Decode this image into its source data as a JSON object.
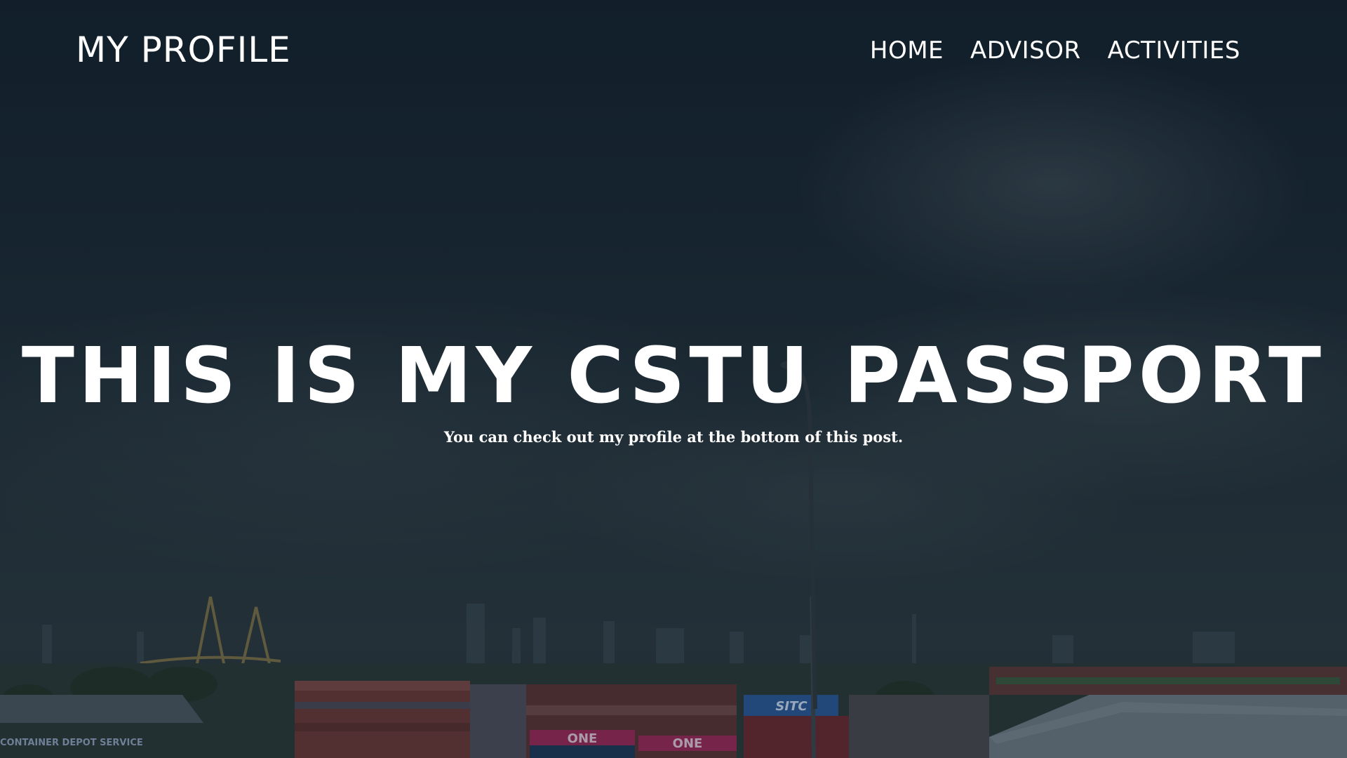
{
  "header": {
    "brand": "MY PROFILE",
    "nav": [
      {
        "label": "HOME"
      },
      {
        "label": "ADVISOR"
      },
      {
        "label": "ACTIVITIES"
      }
    ]
  },
  "hero": {
    "title": "THIS IS MY CSTU PASSPORT",
    "subtitle": "You can check out my profile at the bottom of this post."
  },
  "background": {
    "scene_text": {
      "container_1": "ONE",
      "container_2": "ONE",
      "container_3": "SITC",
      "building_sign": "CONTAINER DEPOT SERVICE"
    }
  },
  "colors": {
    "text": "#ffffff",
    "sky_dark": "#142330",
    "sky_light": "#2b3a42"
  }
}
